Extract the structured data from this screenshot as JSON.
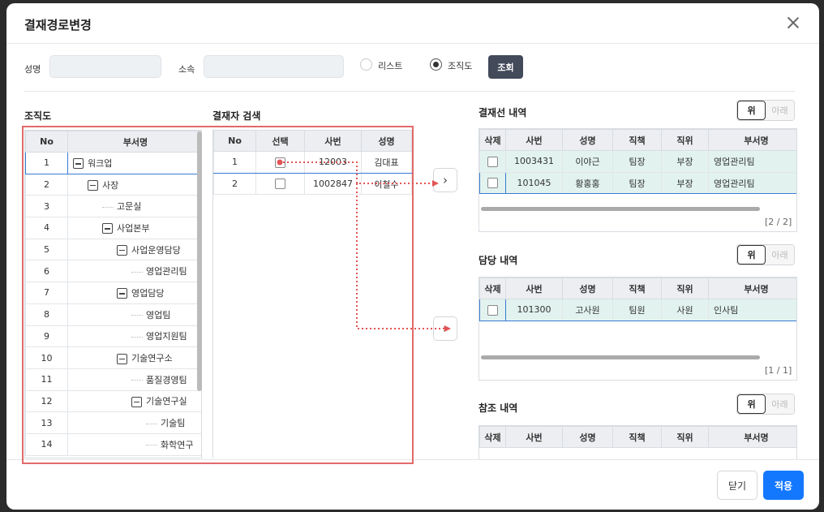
{
  "dialog": {
    "title": "결재경로변경"
  },
  "search": {
    "name_label": "성명",
    "dept_label": "소속",
    "name_value": "",
    "dept_value": "",
    "view_list": "리스트",
    "view_org": "조직도",
    "search_button": "조회"
  },
  "org": {
    "title": "조직도",
    "headers": [
      "No",
      "부서명"
    ],
    "rows": [
      {
        "no": "1",
        "name": "워크업"
      },
      {
        "no": "2",
        "name": "사장"
      },
      {
        "no": "3",
        "name": "고문실"
      },
      {
        "no": "4",
        "name": "사업본부"
      },
      {
        "no": "5",
        "name": "사업운영담당"
      },
      {
        "no": "6",
        "name": "영업관리팀"
      },
      {
        "no": "7",
        "name": "영업담당"
      },
      {
        "no": "8",
        "name": "영업팀"
      },
      {
        "no": "9",
        "name": "영업지원팀"
      },
      {
        "no": "10",
        "name": "기술연구소"
      },
      {
        "no": "11",
        "name": "품질경영팀"
      },
      {
        "no": "12",
        "name": "기술연구실"
      },
      {
        "no": "13",
        "name": "기술팀"
      },
      {
        "no": "14",
        "name": "화학연구"
      }
    ]
  },
  "approver_search": {
    "title": "결재자 검색",
    "headers": [
      "No",
      "선택",
      "사번",
      "성명"
    ],
    "rows": [
      {
        "no": "1",
        "id": "12003",
        "name": "김대표"
      },
      {
        "no": "2",
        "id": "1002847",
        "name": "이철수"
      }
    ]
  },
  "approval_line": {
    "title": "결재선 내역",
    "up": "위",
    "down": "아래",
    "headers": [
      "삭제",
      "사번",
      "성명",
      "직책",
      "직위",
      "부서명"
    ],
    "rows": [
      {
        "id": "1003431",
        "name": "이야근",
        "duty": "팀장",
        "rank": "부장",
        "dept": "영업관리팀"
      },
      {
        "id": "101045",
        "name": "황홍홍",
        "duty": "팀장",
        "rank": "부장",
        "dept": "영업관리팀"
      }
    ],
    "pager": "[2 / 2]"
  },
  "handler_line": {
    "title": "담당 내역",
    "up": "위",
    "down": "아래",
    "headers": [
      "삭제",
      "사번",
      "성명",
      "직책",
      "직위",
      "부서명"
    ],
    "rows": [
      {
        "id": "101300",
        "name": "고사원",
        "duty": "팀원",
        "rank": "사원",
        "dept": "인사팀"
      }
    ],
    "pager": "[1 / 1]"
  },
  "reference_line": {
    "title": "참조 내역",
    "up": "위",
    "down": "아래",
    "headers": [
      "삭제",
      "사번",
      "성명",
      "직책",
      "직위",
      "부서명"
    ]
  },
  "footer": {
    "close": "닫기",
    "apply": "적용"
  },
  "colors": {
    "accent": "#1478ff",
    "highlight": "#e26a6a",
    "row_highlight": "#e2f3ef",
    "search_button": "#434a5a"
  }
}
